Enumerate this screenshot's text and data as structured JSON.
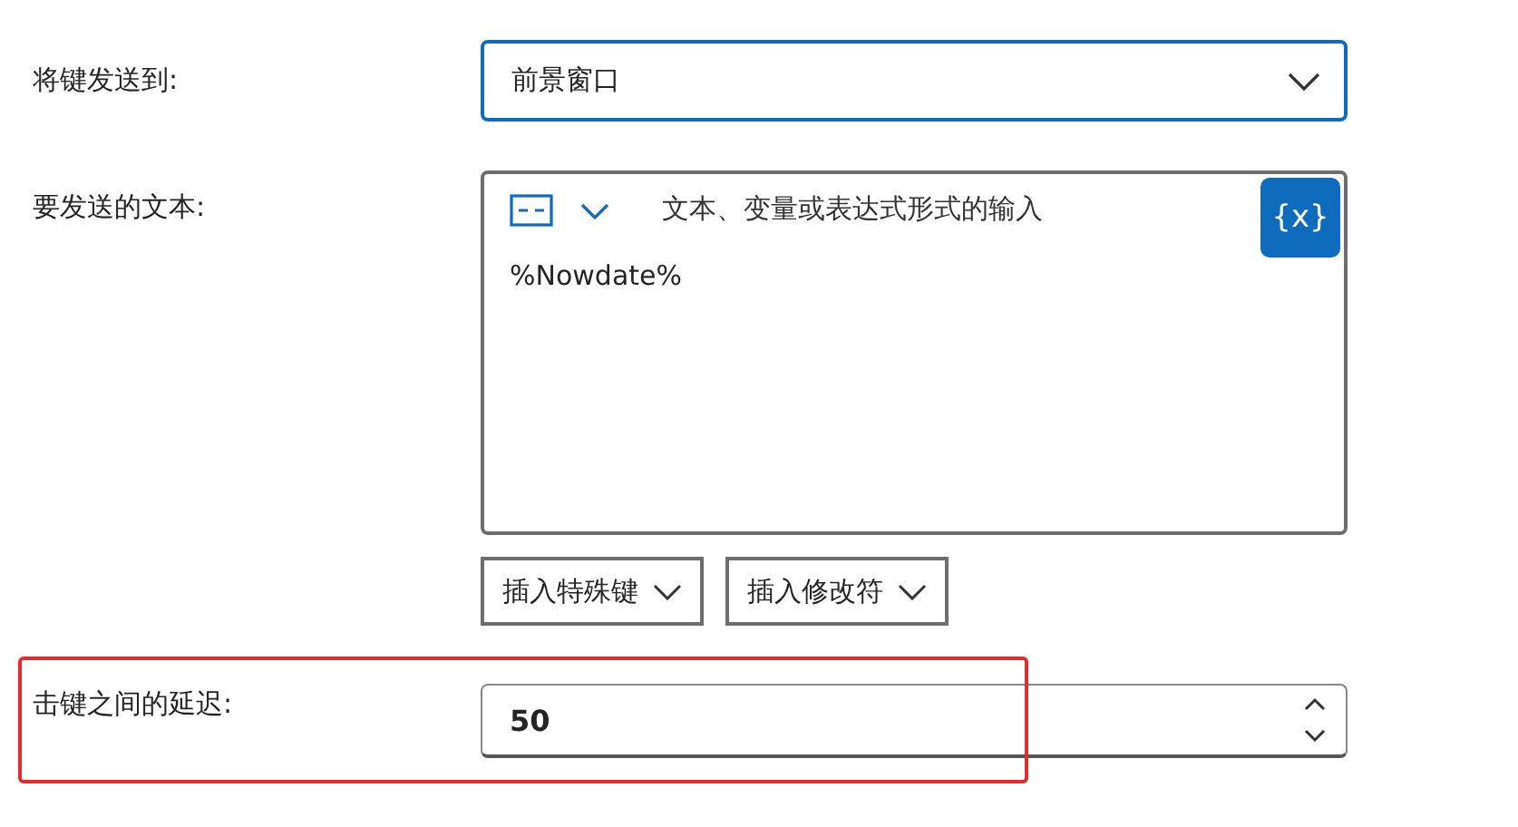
{
  "send_to": {
    "label": "将键发送到:",
    "value": "前景窗口",
    "focused": true
  },
  "text_to_send": {
    "label": "要发送的文本:",
    "placeholder": "文本、变量或表达式形式的输入",
    "value": "%Nowdate%",
    "variable_button": "{x}"
  },
  "insert_buttons": [
    {
      "label": "插入特殊键"
    },
    {
      "label": "插入修改符"
    }
  ],
  "delay": {
    "label": "击键之间的延迟:",
    "value": "50",
    "highlighted": true
  }
}
